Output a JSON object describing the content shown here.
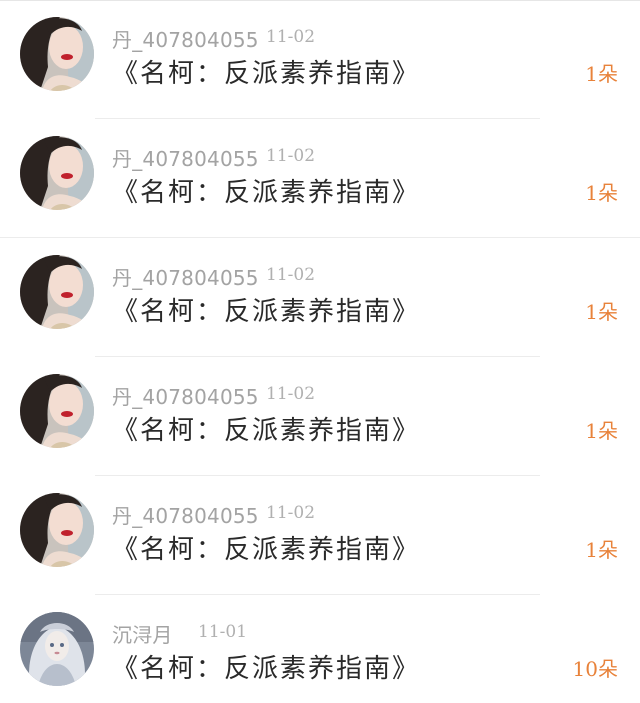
{
  "gifts": [
    {
      "user": "丹_407804055",
      "date": "11-02",
      "title": "《名柯：反派素养指南》",
      "amount": "1朵",
      "avatar": "woman-red-lips-avatar"
    },
    {
      "user": "丹_407804055",
      "date": "11-02",
      "title": "《名柯：反派素养指南》",
      "amount": "1朵",
      "avatar": "woman-red-lips-avatar"
    },
    {
      "user": "丹_407804055",
      "date": "11-02",
      "title": "《名柯：反派素养指南》",
      "amount": "1朵",
      "avatar": "woman-red-lips-avatar"
    },
    {
      "user": "丹_407804055",
      "date": "11-02",
      "title": "《名柯：反派素养指南》",
      "amount": "1朵",
      "avatar": "woman-red-lips-avatar"
    },
    {
      "user": "丹_407804055",
      "date": "11-02",
      "title": "《名柯：反派素养指南》",
      "amount": "1朵",
      "avatar": "woman-red-lips-avatar"
    },
    {
      "user": "沉浔月",
      "date": "11-01",
      "title": "《名柯：反派素养指南》",
      "amount": "10朵",
      "avatar": "doll-portrait-avatar"
    }
  ],
  "colors": {
    "username": "#a3a3a3",
    "date": "#b0b0b0",
    "title": "#2a2a2a",
    "amount": "#e8823a"
  }
}
